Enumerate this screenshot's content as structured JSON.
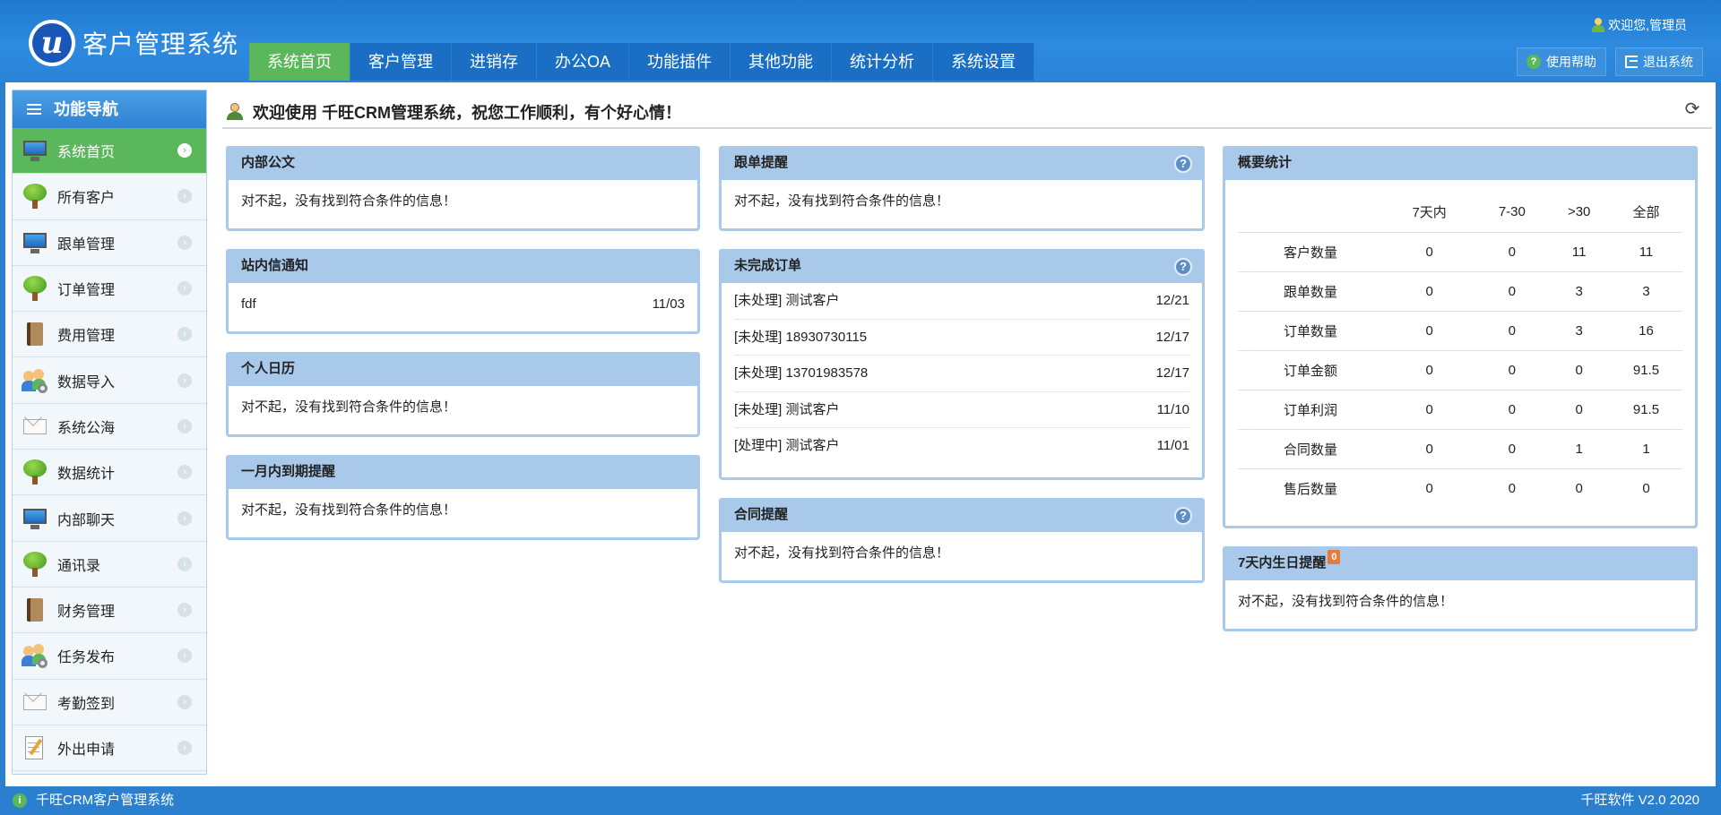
{
  "app": {
    "logo_text": "客户管理系统",
    "welcome": "欢迎您,管理员",
    "help_label": "使用帮助",
    "logout_label": "退出系统"
  },
  "topnav": [
    {
      "label": "系统首页",
      "active": true
    },
    {
      "label": "客户管理"
    },
    {
      "label": "进销存"
    },
    {
      "label": "办公OA"
    },
    {
      "label": "功能插件"
    },
    {
      "label": "其他功能"
    },
    {
      "label": "统计分析"
    },
    {
      "label": "系统设置"
    }
  ],
  "sidebar": {
    "title": "功能导航",
    "items": [
      {
        "label": "系统首页",
        "icon": "monitor-icon",
        "active": true
      },
      {
        "label": "所有客户",
        "icon": "tree-icon"
      },
      {
        "label": "跟单管理",
        "icon": "monitor-icon"
      },
      {
        "label": "订单管理",
        "icon": "tree-icon"
      },
      {
        "label": "费用管理",
        "icon": "book-icon"
      },
      {
        "label": "数据导入",
        "icon": "users-gear-icon"
      },
      {
        "label": "系统公海",
        "icon": "envelope-icon"
      },
      {
        "label": "数据统计",
        "icon": "tree-icon"
      },
      {
        "label": "内部聊天",
        "icon": "monitor-icon"
      },
      {
        "label": "通讯录",
        "icon": "tree-icon"
      },
      {
        "label": "财务管理",
        "icon": "book-icon"
      },
      {
        "label": "任务发布",
        "icon": "users-gear-icon"
      },
      {
        "label": "考勤签到",
        "icon": "envelope-icon"
      },
      {
        "label": "外出申请",
        "icon": "notepad-icon"
      }
    ]
  },
  "content": {
    "title": "欢迎使用 千旺CRM管理系统，祝您工作顺利，有个好心情！"
  },
  "panels": {
    "internal_docs": {
      "title": "内部公文",
      "empty": "对不起，没有找到符合条件的信息！"
    },
    "site_messages": {
      "title": "站内信通知",
      "rows": [
        {
          "text": "fdf",
          "date": "11/03"
        }
      ]
    },
    "calendar": {
      "title": "个人日历",
      "empty": "对不起，没有找到符合条件的信息！"
    },
    "expiry": {
      "title": "一月内到期提醒",
      "empty": "对不起，没有找到符合条件的信息！"
    },
    "followup": {
      "title": "跟单提醒",
      "empty": "对不起，没有找到符合条件的信息！"
    },
    "orders": {
      "title": "未完成订单",
      "rows": [
        {
          "text": "[未处理] 测试客户",
          "date": "12/21"
        },
        {
          "text": "[未处理] 18930730115",
          "date": "12/17"
        },
        {
          "text": "[未处理] 13701983578",
          "date": "12/17"
        },
        {
          "text": "[未处理] 测试客户",
          "date": "11/10"
        },
        {
          "text": "[处理中] 测试客户",
          "date": "11/01"
        }
      ]
    },
    "contracts": {
      "title": "合同提醒",
      "empty": "对不起，没有找到符合条件的信息！"
    },
    "summary": {
      "title": "概要统计",
      "columns": [
        "",
        "7天内",
        "7-30",
        ">30",
        "全部"
      ],
      "rows": [
        [
          "客户数量",
          "0",
          "0",
          "11",
          "11"
        ],
        [
          "跟单数量",
          "0",
          "0",
          "3",
          "3"
        ],
        [
          "订单数量",
          "0",
          "0",
          "3",
          "16"
        ],
        [
          "订单金额",
          "0",
          "0",
          "0",
          "91.5"
        ],
        [
          "订单利润",
          "0",
          "0",
          "0",
          "91.5"
        ],
        [
          "合同数量",
          "0",
          "0",
          "1",
          "1"
        ],
        [
          "售后数量",
          "0",
          "0",
          "0",
          "0"
        ]
      ]
    },
    "birthday": {
      "title": "7天内生日提醒",
      "badge": "0",
      "empty": "对不起，没有找到符合条件的信息！"
    }
  },
  "footer": {
    "left": "千旺CRM客户管理系统",
    "right": "千旺软件 V2.0 2020"
  },
  "colors": {
    "header_blue": "#2a84d8",
    "active_green": "#5bb75b",
    "panel_header": "#a8c9ea"
  }
}
